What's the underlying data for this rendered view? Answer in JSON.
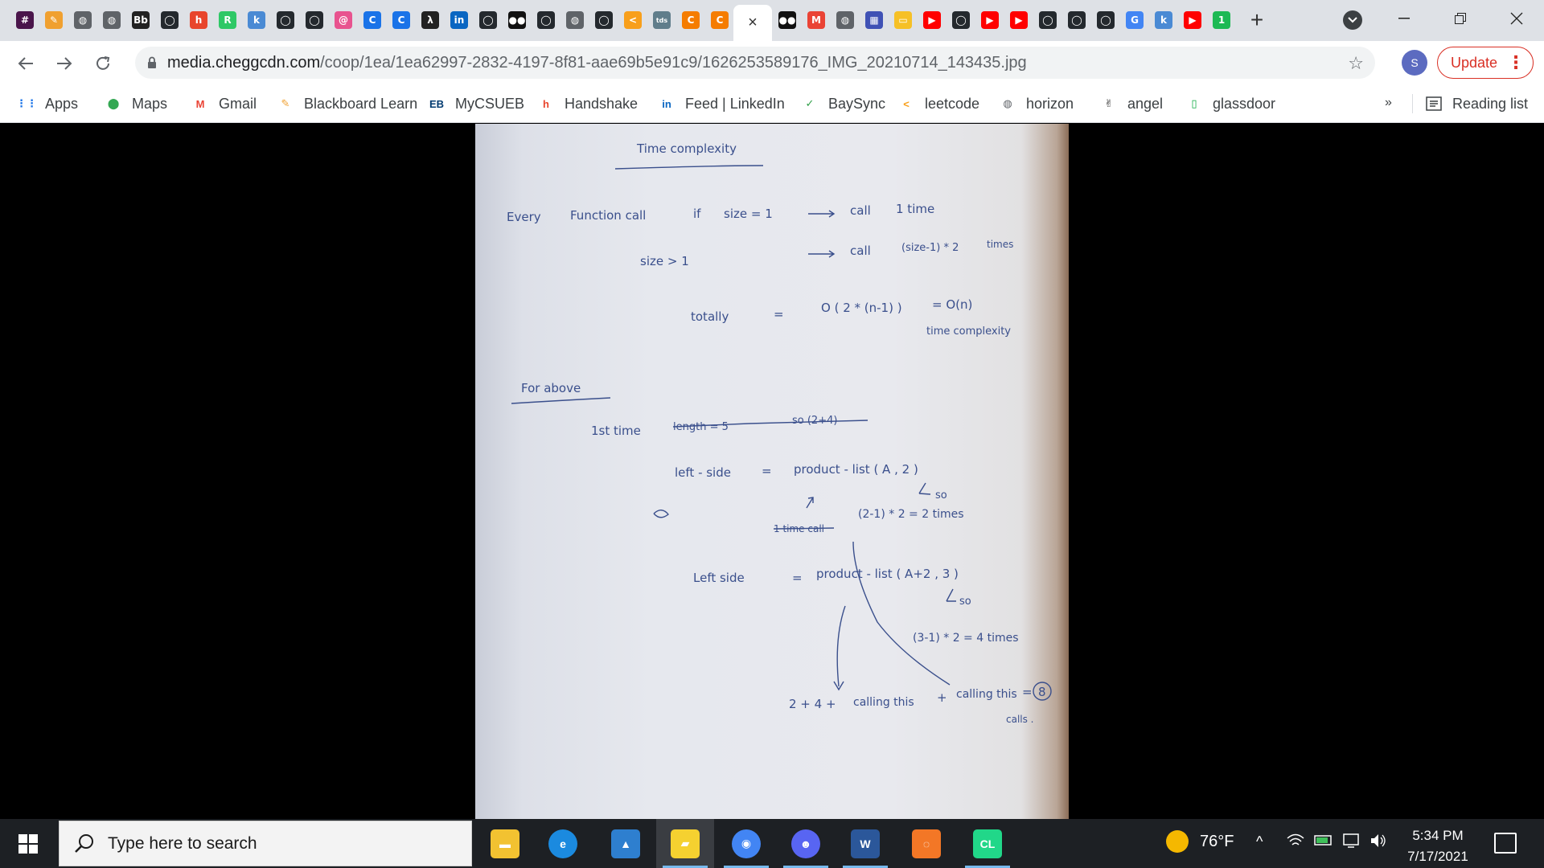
{
  "browser": {
    "tabs": [
      {
        "icon": "slack-icon",
        "color": "#4a154b",
        "glyph": "#"
      },
      {
        "icon": "blackboard-pencil-icon",
        "color": "#f0a030",
        "glyph": "✎"
      },
      {
        "icon": "globe-icon",
        "color": "#5f6368",
        "glyph": "◍"
      },
      {
        "icon": "globe-icon",
        "color": "#5f6368",
        "glyph": "◍"
      },
      {
        "icon": "blackboard-icon",
        "color": "#222222",
        "glyph": "Bb"
      },
      {
        "icon": "github-icon",
        "color": "#24292e",
        "glyph": "◯"
      },
      {
        "icon": "handshake-icon",
        "color": "#e8452c",
        "glyph": "h"
      },
      {
        "icon": "hackerrank-icon",
        "color": "#2ec866",
        "glyph": "R"
      },
      {
        "icon": "k-icon",
        "color": "#4a8ad4",
        "glyph": "k"
      },
      {
        "icon": "github-icon",
        "color": "#24292e",
        "glyph": "◯"
      },
      {
        "icon": "github-icon",
        "color": "#24292e",
        "glyph": "◯"
      },
      {
        "icon": "swirl-icon",
        "color": "#e8538f",
        "glyph": "@"
      },
      {
        "icon": "chegg-c-icon",
        "color": "#1a73e8",
        "glyph": "C"
      },
      {
        "icon": "chegg-c-icon",
        "color": "#1a73e8",
        "glyph": "C"
      },
      {
        "icon": "lambda-icon",
        "color": "#222222",
        "glyph": "λ"
      },
      {
        "icon": "linkedin-icon",
        "color": "#0a66c2",
        "glyph": "in"
      },
      {
        "icon": "github-icon",
        "color": "#24292e",
        "glyph": "◯"
      },
      {
        "icon": "medium-icon",
        "color": "#111111",
        "glyph": "●●"
      },
      {
        "icon": "github-icon",
        "color": "#24292e",
        "glyph": "◯"
      },
      {
        "icon": "globe-icon",
        "color": "#5f6368",
        "glyph": "◍"
      },
      {
        "icon": "github-icon",
        "color": "#24292e",
        "glyph": "◯"
      },
      {
        "icon": "leetcode-icon",
        "color": "#f89f1b",
        "glyph": "<"
      },
      {
        "icon": "tds-icon",
        "color": "#607d8b",
        "glyph": "tds"
      },
      {
        "icon": "chegg-c-icon",
        "color": "#f57c00",
        "glyph": "C"
      },
      {
        "icon": "chegg-c-icon",
        "color": "#f57c00",
        "glyph": "C"
      }
    ],
    "tabs_after": [
      {
        "icon": "medium-icon",
        "color": "#111111",
        "glyph": "●●"
      },
      {
        "icon": "gmail-icon",
        "color": "#ea4335",
        "glyph": "M"
      },
      {
        "icon": "globe-icon",
        "color": "#5f6368",
        "glyph": "◍"
      },
      {
        "icon": "calendar-icon",
        "color": "#3f51b5",
        "glyph": "▦"
      },
      {
        "icon": "note-icon",
        "color": "#f6c026",
        "glyph": "▭"
      },
      {
        "icon": "youtube-icon",
        "color": "#ff0000",
        "glyph": "▶"
      },
      {
        "icon": "github-icon",
        "color": "#24292e",
        "glyph": "◯"
      },
      {
        "icon": "youtube-icon",
        "color": "#ff0000",
        "glyph": "▶"
      },
      {
        "icon": "youtube-icon",
        "color": "#ff0000",
        "glyph": "▶"
      },
      {
        "icon": "github-icon",
        "color": "#24292e",
        "glyph": "◯"
      },
      {
        "icon": "github-icon",
        "color": "#24292e",
        "glyph": "◯"
      },
      {
        "icon": "github-icon",
        "color": "#24292e",
        "glyph": "◯"
      },
      {
        "icon": "google-icon",
        "color": "#4285f4",
        "glyph": "G"
      },
      {
        "icon": "k-icon",
        "color": "#4a8ad4",
        "glyph": "k"
      },
      {
        "icon": "youtube-icon",
        "color": "#ff0000",
        "glyph": "▶"
      },
      {
        "icon": "one-icon",
        "color": "#1db954",
        "glyph": "1"
      }
    ],
    "active_tab_close": "×",
    "new_tab_label": "+",
    "url_host": "media.cheggcdn.com",
    "url_path": "/coop/1ea/1ea62997-2832-4197-8f81-aae69b5e91c9/1626253589176_IMG_20210714_143435.jpg",
    "profile_initial": "S",
    "update_label": "Update",
    "update_menu": "⋮"
  },
  "bookmarks": [
    {
      "label": "Apps",
      "icon": "apps-grid-icon",
      "color": "#1a73e8",
      "glyph": "⋮⋮"
    },
    {
      "label": "Maps",
      "icon": "maps-pin-icon",
      "color": "#34a853",
      "glyph": "⬤"
    },
    {
      "label": "Gmail",
      "icon": "gmail-icon",
      "color": "#ea4335",
      "glyph": "M"
    },
    {
      "label": "Blackboard Learn",
      "icon": "blackboard-pencil-icon",
      "color": "#f0a030",
      "glyph": "✎"
    },
    {
      "label": "MyCSUEB",
      "icon": "csueb-icon",
      "color": "#003a70",
      "glyph": "EB"
    },
    {
      "label": "Handshake",
      "icon": "handshake-icon",
      "color": "#e8452c",
      "glyph": "h"
    },
    {
      "label": "Feed | LinkedIn",
      "icon": "linkedin-icon",
      "color": "#0a66c2",
      "glyph": "in"
    },
    {
      "label": "BaySync",
      "icon": "check-shield-icon",
      "color": "#2e9e47",
      "glyph": "✓"
    },
    {
      "label": "leetcode",
      "icon": "leetcode-icon",
      "color": "#f89f1b",
      "glyph": "<"
    },
    {
      "label": "horizon",
      "icon": "globe-icon",
      "color": "#5f6368",
      "glyph": "◍"
    },
    {
      "label": "angel",
      "icon": "angel-hand-icon",
      "color": "#222222",
      "glyph": "✌"
    },
    {
      "label": "glassdoor",
      "icon": "glassdoor-icon",
      "color": "#0caa41",
      "glyph": "▯"
    }
  ],
  "bookmarks_overflow": "»",
  "reading_list": "Reading list",
  "note": {
    "title": "Time complexity",
    "l1_a": "Every",
    "l1_b": "Function call",
    "l1_c": "if",
    "l1_d": "size = 1",
    "l1_e": "call",
    "l1_f": "1 time",
    "l2_a": "size > 1",
    "l2_b": "call",
    "l2_c": "(size-1) * 2",
    "l2_d": "times",
    "l3_a": "totally",
    "l3_b": "=",
    "l3_c": "O ( 2 * (n-1) )",
    "l3_d": "= O(n)",
    "l3_e": "time complexity",
    "for_above": "For above",
    "first_time": "1st time",
    "struck_1": "length = 5",
    "struck_2": "so (2+4)",
    "left1_a": "left - side",
    "left1_b": "=",
    "left1_c": "product - list ( A , 2 )",
    "so1": "so",
    "struck_3": "1 time call",
    "calc1": "(2-1) * 2  = 2 times",
    "left2_a": "Left side",
    "left2_b": "=",
    "left2_c": "product - list ( A+2 , 3 )",
    "so2": "so",
    "calc2": "(3-1) * 2 = 4 times",
    "final_a": "2 + 4  +",
    "final_b": "calling this",
    "final_c": "+",
    "final_d": "calling this",
    "final_e": "=",
    "final_f": "8",
    "final_g": "calls ."
  },
  "taskbar": {
    "search_placeholder": "Type here to search",
    "apps": [
      {
        "icon": "file-explorer-icon",
        "color": "#f2c231",
        "glyph": "▬"
      },
      {
        "icon": "edge-icon",
        "color": "#1b8adf",
        "glyph": "e"
      },
      {
        "icon": "photos-icon",
        "color": "#2e7fcf",
        "glyph": "▲"
      },
      {
        "icon": "sticky-notes-icon",
        "color": "#f5d130",
        "glyph": "▰"
      },
      {
        "icon": "chrome-icon",
        "color": "#4285f4",
        "glyph": "◉"
      },
      {
        "icon": "discord-icon",
        "color": "#5865f2",
        "glyph": "☻"
      },
      {
        "icon": "word-icon",
        "color": "#2b579a",
        "glyph": "W"
      },
      {
        "icon": "jupyter-icon",
        "color": "#f37726",
        "glyph": "◌"
      },
      {
        "icon": "clion-icon",
        "color": "#21d789",
        "glyph": "CL"
      }
    ],
    "weather_temp": "76°F",
    "time": "5:34 PM",
    "date": "7/17/2021"
  }
}
